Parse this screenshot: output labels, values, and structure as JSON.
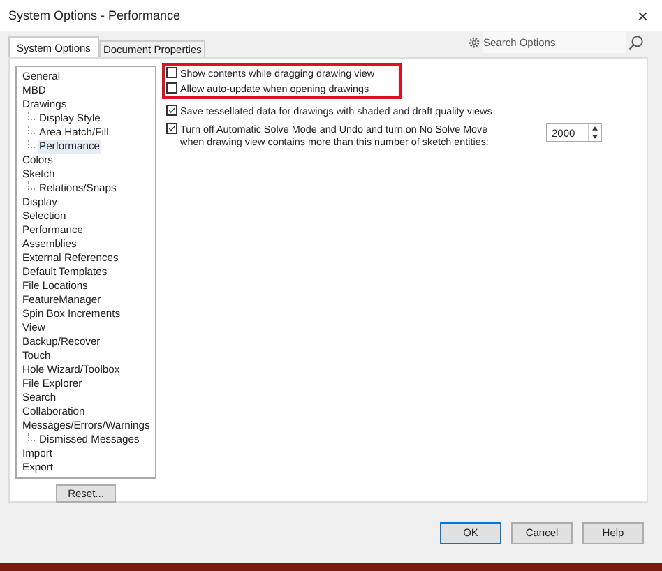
{
  "window": {
    "title": "System Options - Performance",
    "close": "×"
  },
  "tabs": [
    {
      "label": "System Options",
      "selected": true
    },
    {
      "label": "Document Properties",
      "selected": false
    }
  ],
  "search": {
    "placeholder": "Search Options"
  },
  "tree": [
    {
      "label": "General",
      "selected": false
    },
    {
      "label": "MBD",
      "selected": false
    },
    {
      "label": "Drawings",
      "selected": false,
      "children": [
        {
          "label": "Display Style",
          "selected": false
        },
        {
          "label": "Area Hatch/Fill",
          "selected": false
        },
        {
          "label": "Performance",
          "selected": true
        }
      ]
    },
    {
      "label": "Colors",
      "selected": false
    },
    {
      "label": "Sketch",
      "selected": false,
      "children": [
        {
          "label": "Relations/Snaps",
          "selected": false
        }
      ]
    },
    {
      "label": "Display",
      "selected": false
    },
    {
      "label": "Selection",
      "selected": false
    },
    {
      "label": "Performance",
      "selected": false
    },
    {
      "label": "Assemblies",
      "selected": false
    },
    {
      "label": "External References",
      "selected": false
    },
    {
      "label": "Default Templates",
      "selected": false
    },
    {
      "label": "File Locations",
      "selected": false
    },
    {
      "label": "FeatureManager",
      "selected": false
    },
    {
      "label": "Spin Box Increments",
      "selected": false
    },
    {
      "label": "View",
      "selected": false
    },
    {
      "label": "Backup/Recover",
      "selected": false
    },
    {
      "label": "Touch",
      "selected": false
    },
    {
      "label": "Hole Wizard/Toolbox",
      "selected": false
    },
    {
      "label": "File Explorer",
      "selected": false
    },
    {
      "label": "Search",
      "selected": false
    },
    {
      "label": "Collaboration",
      "selected": false
    },
    {
      "label": "Messages/Errors/Warnings",
      "selected": false,
      "children": [
        {
          "label": "Dismissed Messages",
          "selected": false
        }
      ]
    },
    {
      "label": "Import",
      "selected": false
    },
    {
      "label": "Export",
      "selected": false
    }
  ],
  "highlighted_options": [
    {
      "label": "Show contents while dragging drawing view",
      "checked": false
    },
    {
      "label": "Allow auto-update when opening drawings",
      "checked": false
    }
  ],
  "options": [
    {
      "label": "Save tessellated data for drawings with shaded and draft quality views",
      "checked": true
    },
    {
      "label": "Turn off Automatic Solve Mode and Undo and turn on No Solve Move when drawing view contains more than this number of sketch entities:",
      "checked": true,
      "value": "2000"
    }
  ],
  "reset_button": "Reset...",
  "buttons": [
    {
      "label": "OK",
      "default": true
    },
    {
      "label": "Cancel",
      "default": false
    },
    {
      "label": "Help",
      "default": false
    }
  ]
}
